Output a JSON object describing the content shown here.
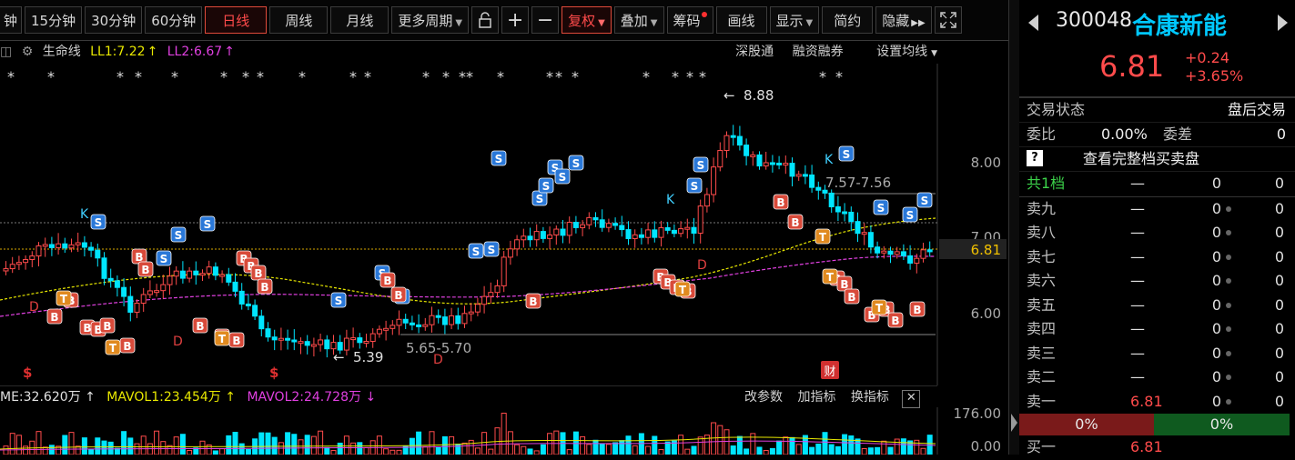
{
  "toolbar": {
    "items": [
      "钟",
      "15分钟",
      "30分钟",
      "60分钟",
      "日线",
      "周线",
      "月线",
      "更多周期"
    ],
    "adjust": "复权",
    "overlay": "叠加",
    "chip": "筹码",
    "draw": "画线",
    "display": "显示",
    "simple": "简约",
    "hide": "隐藏"
  },
  "indicator": {
    "name": "生命线",
    "ll1": "LL1:7.22",
    "ll2": "LL2:6.67",
    "up": "↑"
  },
  "links": {
    "a": "深股通",
    "b": "融资融券",
    "c": "设置均线"
  },
  "price_axis": {
    "p8": "8.00",
    "p7": "7.00",
    "p6": "6.00",
    "last": "6.81"
  },
  "annotations": {
    "high": "8.88",
    "low": "5.39",
    "range1": "7.57-7.56",
    "range2": "5.65-5.70",
    "cai": "财"
  },
  "volume": {
    "vol": "ME:32.620万",
    "mavol1": "MAVOL1:23.454万",
    "mavol2": "MAVOL2:24.728万",
    "up": "↑",
    "down": "↓",
    "btn1": "改参数",
    "btn2": "加指标",
    "btn3": "换指标",
    "axis_top": "176.00",
    "axis_bottom": "0.00"
  },
  "quote": {
    "code": "300048",
    "name": "合康新能",
    "price": "6.81",
    "change": "+0.24",
    "pct": "+3.65%",
    "state_label": "交易状态",
    "state_value": "盘后交易",
    "ratio_label": "委比",
    "ratio_value": "0.00%",
    "diff_label": "委差",
    "diff_value": "0",
    "full_book": "查看完整档买卖盘",
    "help": "?",
    "levels_label": "共1档",
    "dash": "—",
    "zero": "0",
    "asks": [
      "卖九",
      "卖八",
      "卖七",
      "卖六",
      "卖五",
      "卖四",
      "卖三",
      "卖二",
      "卖一"
    ],
    "ask1_price": "6.81",
    "bid_pct": "0%",
    "ask_pct": "0%",
    "buy1_label": "买一",
    "buy1_price": "6.81"
  },
  "colors": {
    "up": "#ff4b4b",
    "down": "#00e5ff",
    "accent": "#00c8ff",
    "ll1": "#e8e800",
    "ll2": "#e040e0"
  }
}
